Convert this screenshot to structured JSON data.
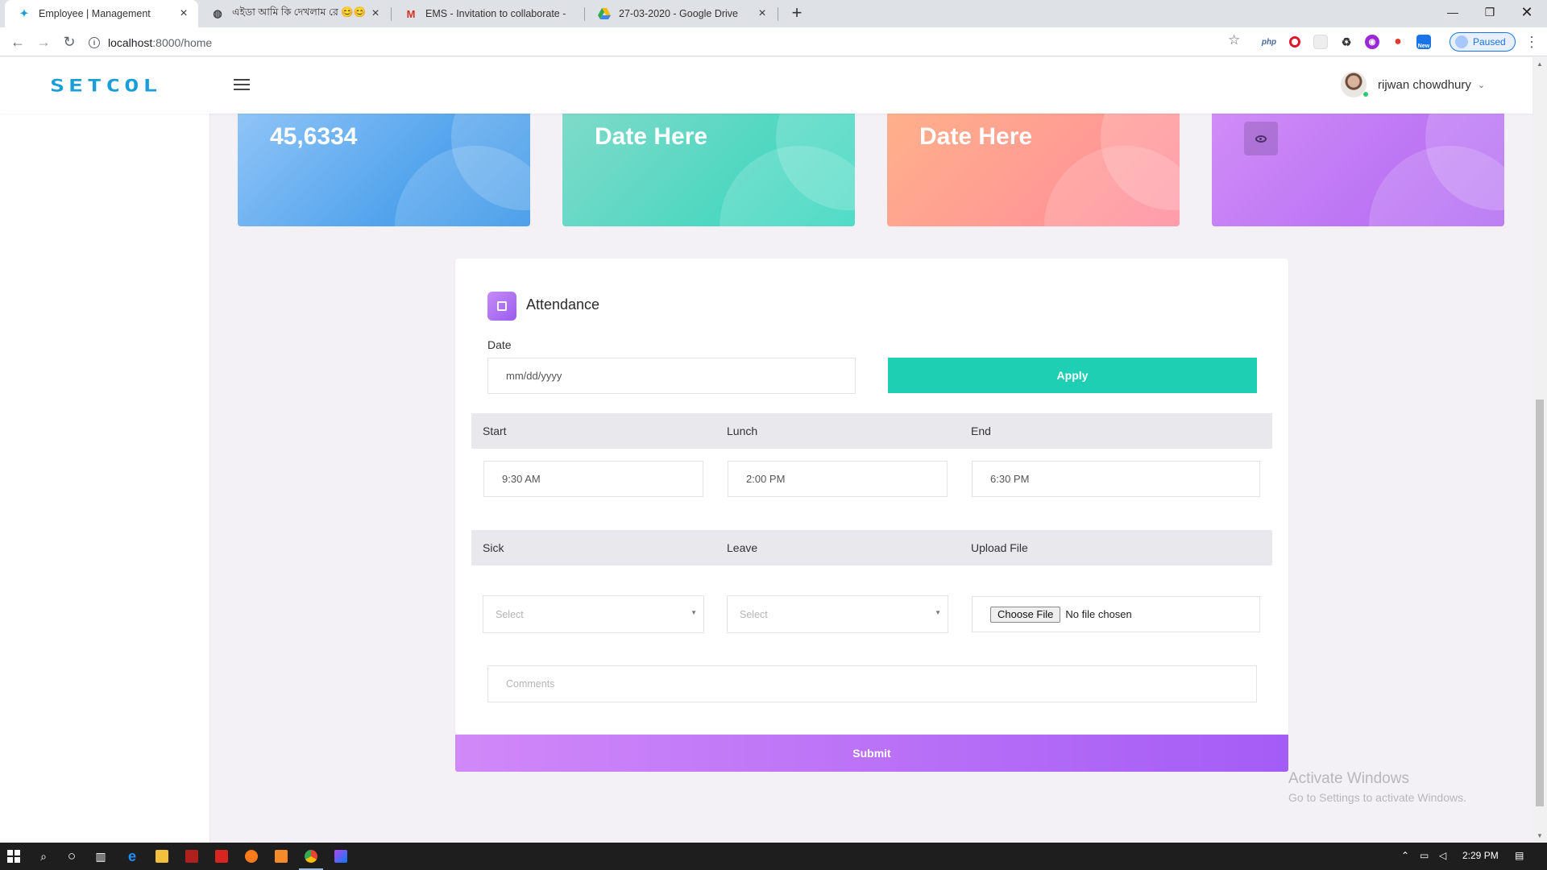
{
  "browser": {
    "tabs": [
      {
        "title": "Employee | Management",
        "active": true
      },
      {
        "title": "এইডা আমি কি দেখলাম রে 😊😊"
      },
      {
        "title": "EMS - Invitation to collaborate -"
      },
      {
        "title": "27-03-2020 - Google Drive"
      }
    ],
    "url_host": "localhost",
    "url_rest": ":8000/home",
    "profile_status": "Paused",
    "ext_php": "php",
    "ext_new": "New"
  },
  "app": {
    "logo": "SETCOL",
    "user_name": "rijwan chowdhury"
  },
  "stats": [
    {
      "value": "45,6334",
      "color_from": "#8fc4f7",
      "color_to": "#2c8fe6"
    },
    {
      "value": "Date Here",
      "color_from": "#7fdac9",
      "color_to": "#30d6bd"
    },
    {
      "value": "Date Here",
      "color_from": "#ffb08a",
      "color_to": "#ff8a9c"
    },
    {
      "value": "",
      "color_from": "#d08cf7",
      "color_to": "#b067f2"
    }
  ],
  "attendance": {
    "title": "Attendance",
    "date_label": "Date",
    "date_placeholder": "mm/dd/yyyy",
    "apply_label": "Apply",
    "headers_row1": [
      "Start",
      "Lunch",
      "End"
    ],
    "start_value": "9:30 AM",
    "lunch_value": "2:00 PM",
    "end_value": "6:30 PM",
    "headers_row2": [
      "Sick",
      "Leave",
      "Upload File"
    ],
    "sick_value": "Select",
    "leave_value": "Select",
    "choose_file_label": "Choose File",
    "no_file_label": "No file chosen",
    "comments_placeholder": "Comments",
    "submit_label": "Submit"
  },
  "watermark": {
    "line1": "Activate Windows",
    "line2": "Go to Settings to activate Windows."
  },
  "taskbar": {
    "time": "2:29 PM"
  },
  "colors": {
    "accent_teal": "#1ecfb3",
    "accent_purple": "#a45cf6",
    "logo_blue": "#1a9ed9"
  }
}
